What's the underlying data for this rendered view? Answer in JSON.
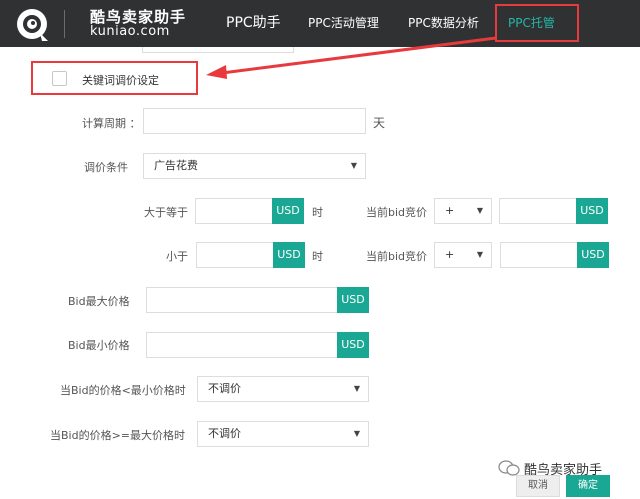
{
  "header": {
    "brand_cn": "酷鸟卖家助手",
    "brand_en": "kuniao.com",
    "nav": [
      "PPC助手",
      "PPC活动管理",
      "PPC数据分析",
      "PPC托管"
    ],
    "active_index": 3,
    "accent_color": "#27b6a8"
  },
  "keyword_setting": {
    "label": "关键词调价设定",
    "checked": false
  },
  "form": {
    "period_label": "计算周期 ：",
    "period_value": "",
    "period_unit": "天",
    "condition_label": "调价条件",
    "condition_value": "广告花费",
    "row_gte": {
      "label": "大于等于",
      "currency": "USD",
      "suffix": "时",
      "bid_label": "当前bid竞价",
      "op": "+",
      "currency2": "USD"
    },
    "row_lt": {
      "label": "小于",
      "currency": "USD",
      "suffix": "时",
      "bid_label": "当前bid竞价",
      "op": "+",
      "currency2": "USD"
    },
    "bid_max": {
      "label": "Bid最大价格",
      "currency": "USD"
    },
    "bid_min": {
      "label": "Bid最小价格",
      "currency": "USD"
    },
    "below_min": {
      "label": "当Bid的价格<最小价格时",
      "value": "不调价"
    },
    "above_max": {
      "label": "当Bid的价格>=最大价格时",
      "value": "不调价"
    }
  },
  "footer": {
    "watermark": "酷鸟卖家助手",
    "cancel": "取消",
    "ok": "确定"
  },
  "colors": {
    "header_bg": "#2f3133",
    "highlight": "#e8393d",
    "primary": "#1aa894"
  }
}
